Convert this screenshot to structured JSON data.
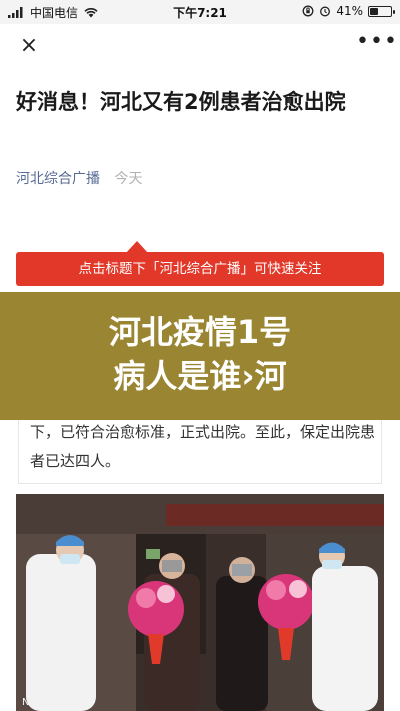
{
  "status_bar": {
    "carrier": "中国电信",
    "time": "下午7:21",
    "battery": "41%",
    "battery_level": 0.41
  },
  "nav": {
    "close_icon": "close-icon",
    "more_icon": "more-icon",
    "close_label": "×",
    "more_label": "•••"
  },
  "article": {
    "title": "好消息！河北又有2例患者治愈出院",
    "source": "河北综合广播",
    "date": "今天"
  },
  "banner": {
    "text": "点击标题下「河北综合广播」可快速关注"
  },
  "overlay": {
    "line1": "河北疫情1号",
    "line2": "病人是谁›河"
  },
  "body": {
    "text": "下，已符合治愈标准，正式出院。至此，保定出院患者已达四人。"
  },
  "photo": {
    "watermark": "NPHU @小花哟"
  },
  "colors": {
    "link": "#576b95",
    "banner": "#e2382a",
    "overlay": "#9a8532"
  }
}
